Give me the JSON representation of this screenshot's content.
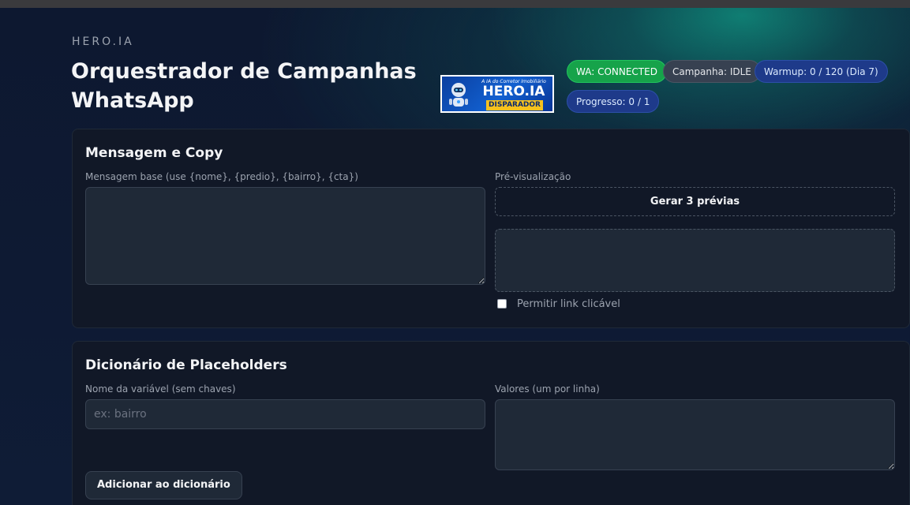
{
  "header": {
    "brand": "HERO.IA",
    "title": "Orquestrador de Campanhas WhatsApp"
  },
  "logo": {
    "tagline": "A IA do Corretor Imobiliário",
    "name": "HERO.IA",
    "sub": "DISPARADOR"
  },
  "status": {
    "wa": "WA: CONNECTED",
    "campaign": "Campanha: IDLE",
    "warmup": "Warmup: 0 / 120 (Dia 7)",
    "progress": "Progresso: 0 / 1"
  },
  "message_card": {
    "title": "Mensagem e Copy",
    "base_label": "Mensagem base (use {nome}, {predio}, {bairro}, {cta})",
    "base_value": "",
    "preview_label": "Pré-visualização",
    "preview_button": "Gerar 3 prévias",
    "allow_link_label": "Permitir link clicável",
    "allow_link_checked": false
  },
  "dictionary_card": {
    "title": "Dicionário de Placeholders",
    "name_label": "Nome da variável (sem chaves)",
    "name_placeholder": "ex: bairro",
    "name_value": "",
    "values_label": "Valores (um por linha)",
    "values_value": "",
    "add_button": "Adicionar ao dicionário"
  },
  "colors": {
    "connected": "#16a34a",
    "idle": "#374151",
    "info": "#1e3a8a",
    "card_bg": "#111827",
    "field_bg": "#1f2937",
    "logo_accent": "#f7c21e"
  }
}
